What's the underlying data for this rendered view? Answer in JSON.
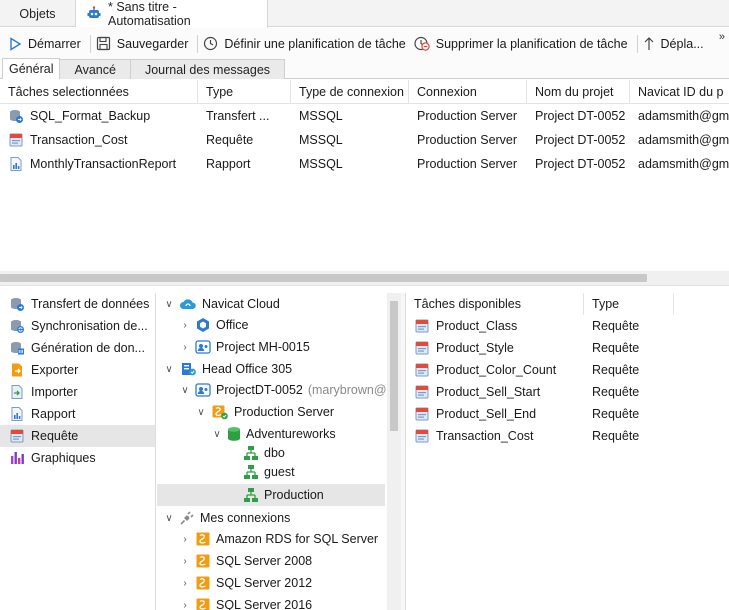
{
  "tabs": {
    "objets": "Objets",
    "automation": "* Sans titre - Automatisation"
  },
  "toolbar": {
    "start": "Démarrer",
    "save": "Sauvegarder",
    "schedule": "Définir une planification de tâche",
    "unschedule": "Supprimer la planification de tâche",
    "move": "Dépla...",
    "more": "»"
  },
  "subtabs": [
    "Général",
    "Avancé",
    "Journal des messages"
  ],
  "grid": {
    "headers": [
      "Tâches selectionnées",
      "Type",
      "Type de connexion",
      "Connexion",
      "Nom du projet",
      "Navicat ID du p"
    ],
    "rows": [
      [
        "SQL_Format_Backup",
        "Transfert ...",
        "MSSQL",
        "Production Server",
        "Project DT-0052",
        "adamsmith@gm"
      ],
      [
        "Transaction_Cost",
        "Requête",
        "MSSQL",
        "Production Server",
        "Project DT-0052",
        "adamsmith@gm"
      ],
      [
        "MonthlyTransactionReport",
        "Rapport",
        "MSSQL",
        "Production Server",
        "Project DT-0052",
        "adamsmith@gm"
      ]
    ]
  },
  "categories": [
    "Transfert de données",
    "Synchronisation de...",
    "Génération de don...",
    "Exporter",
    "Importer",
    "Rapport",
    "Requête",
    "Graphiques"
  ],
  "tree": {
    "navicat_cloud": "Navicat Cloud",
    "office": "Office",
    "project_mh": "Project MH-0015",
    "head_office": "Head Office 305",
    "project_dt": "ProjectDT-0052",
    "project_dt_owner": "(marybrown@",
    "production_server": "Production Server",
    "adventureworks": "Adventureworks",
    "dbo": "dbo",
    "guest": "guest",
    "production": "Production",
    "my_connections": "Mes connexions",
    "amazon_rds": "Amazon RDS for SQL Server",
    "sql2008": "SQL Server 2008",
    "sql2012": "SQL Server 2012",
    "sql2016": "SQL Server 2016"
  },
  "available": {
    "headers": [
      "Tâches disponibles",
      "Type"
    ],
    "rows": [
      [
        "Product_Class",
        "Requête"
      ],
      [
        "Product_Style",
        "Requête"
      ],
      [
        "Product_Color_Count",
        "Requête"
      ],
      [
        "Product_Sell_Start",
        "Requête"
      ],
      [
        "Product_Sell_End",
        "Requête"
      ],
      [
        "Transaction_Cost",
        "Requête"
      ]
    ]
  },
  "colors": {
    "accent": "#2b7bd3",
    "query_red": "#e04b3c",
    "folder_orange": "#f39c12",
    "db_green": "#2ea043"
  }
}
